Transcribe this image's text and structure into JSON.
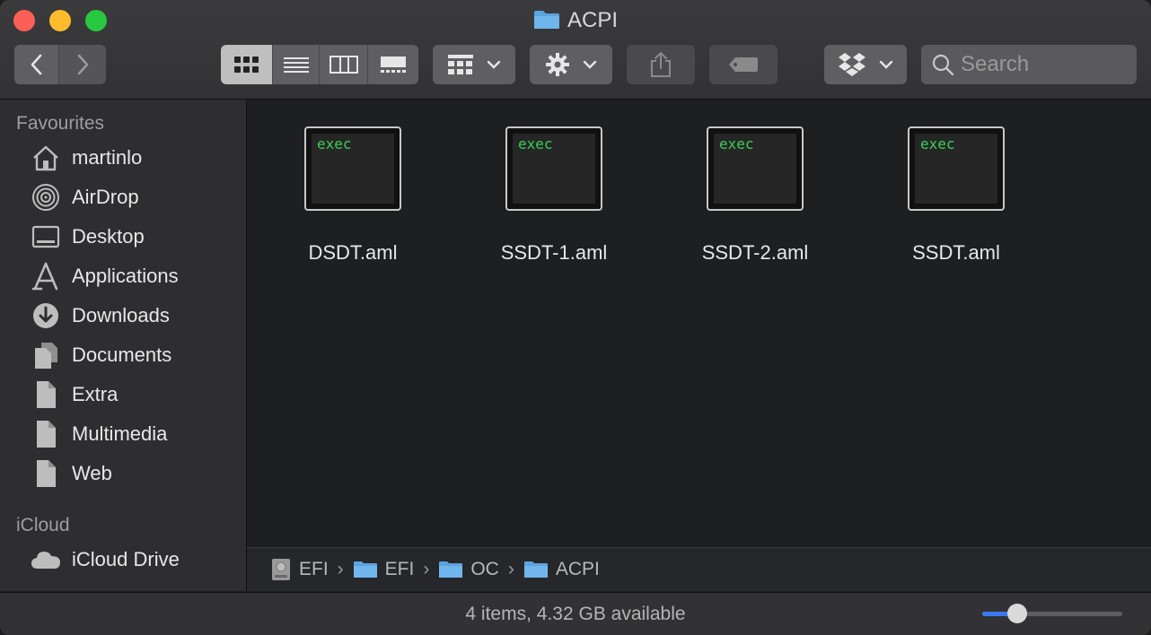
{
  "window": {
    "title": "ACPI"
  },
  "toolbar": {
    "back_icon": "chevron-left-icon",
    "forward_icon": "chevron-right-icon",
    "view_modes": [
      "icon-view",
      "list-view",
      "column-view",
      "gallery-view"
    ],
    "active_view": "icon-view",
    "group_icon": "group-grid-icon",
    "action_icon": "gear-icon",
    "share_icon": "share-icon",
    "tag_icon": "tag-icon",
    "dropbox_icon": "dropbox-icon",
    "search_placeholder": "Search"
  },
  "sidebar": {
    "favourites_heading": "Favourites",
    "items": [
      {
        "label": "martinlo",
        "icon": "home-icon"
      },
      {
        "label": "AirDrop",
        "icon": "airdrop-icon"
      },
      {
        "label": "Desktop",
        "icon": "desktop-icon"
      },
      {
        "label": "Applications",
        "icon": "applications-icon"
      },
      {
        "label": "Downloads",
        "icon": "downloads-icon"
      },
      {
        "label": "Documents",
        "icon": "documents-icon"
      },
      {
        "label": "Extra",
        "icon": "document-icon"
      },
      {
        "label": "Multimedia",
        "icon": "document-icon"
      },
      {
        "label": "Web",
        "icon": "document-icon"
      }
    ],
    "icloud_heading": "iCloud",
    "icloud_items": [
      {
        "label": "iCloud Drive",
        "icon": "cloud-icon"
      }
    ]
  },
  "files": [
    {
      "name": "DSDT.aml",
      "icon_label": "exec"
    },
    {
      "name": "SSDT-1.aml",
      "icon_label": "exec"
    },
    {
      "name": "SSDT-2.aml",
      "icon_label": "exec"
    },
    {
      "name": "SSDT.aml",
      "icon_label": "exec"
    }
  ],
  "path": [
    {
      "label": "EFI",
      "icon": "disk-icon"
    },
    {
      "label": "EFI",
      "icon": "folder-icon"
    },
    {
      "label": "OC",
      "icon": "folder-icon"
    },
    {
      "label": "ACPI",
      "icon": "folder-icon"
    }
  ],
  "status": {
    "text": "4 items, 4.32 GB available",
    "icon_size_fraction": 0.25
  },
  "colors": {
    "accent": "#3b78f0",
    "exec_text": "#3ccf55",
    "folder": "#5ba4e0"
  }
}
